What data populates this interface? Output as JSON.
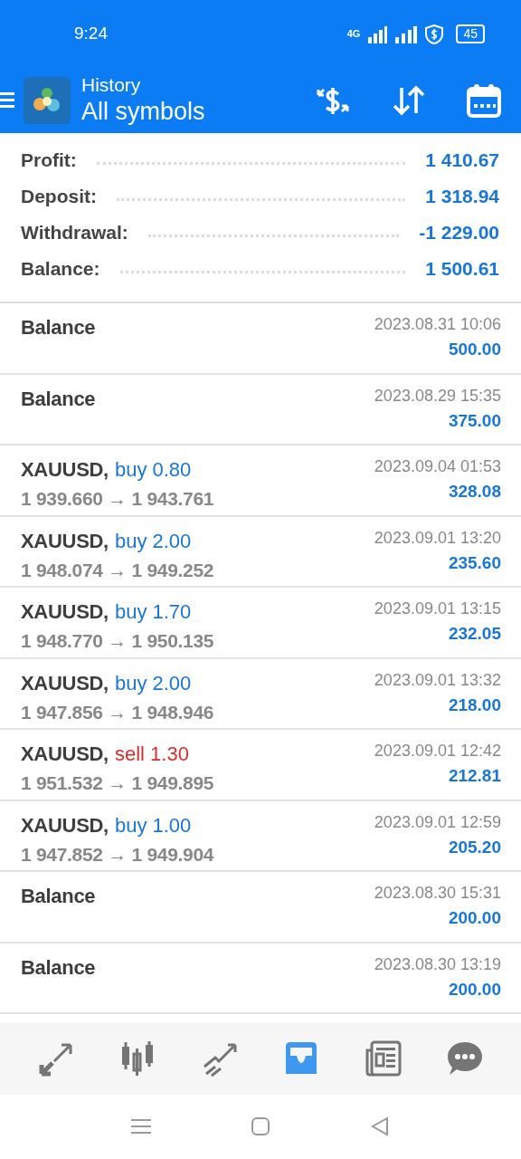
{
  "status_bar": {
    "time": "9:24",
    "network": "4G",
    "battery": "45"
  },
  "header": {
    "subtitle": "History",
    "title": "All symbols"
  },
  "summary": [
    {
      "label": "Profit:",
      "value": "1 410.67"
    },
    {
      "label": "Deposit:",
      "value": "1 318.94"
    },
    {
      "label": "Withdrawal:",
      "value": "-1 229.00"
    },
    {
      "label": "Balance:",
      "value": "1 500.61"
    }
  ],
  "deals": [
    {
      "kind": "balance",
      "title": "Balance",
      "time": "2023.08.31 10:06",
      "amount": "500.00"
    },
    {
      "kind": "balance",
      "title": "Balance",
      "time": "2023.08.29 15:35",
      "amount": "375.00"
    },
    {
      "kind": "trade",
      "symbol": "XAUUSD,",
      "side": "buy",
      "volume": "0.80",
      "prices": "1 939.660 → 1 943.761",
      "time": "2023.09.04 01:53",
      "amount": "328.08"
    },
    {
      "kind": "trade",
      "symbol": "XAUUSD,",
      "side": "buy",
      "volume": "2.00",
      "prices": "1 948.074 → 1 949.252",
      "time": "2023.09.01 13:20",
      "amount": "235.60"
    },
    {
      "kind": "trade",
      "symbol": "XAUUSD,",
      "side": "buy",
      "volume": "1.70",
      "prices": "1 948.770 → 1 950.135",
      "time": "2023.09.01 13:15",
      "amount": "232.05"
    },
    {
      "kind": "trade",
      "symbol": "XAUUSD,",
      "side": "buy",
      "volume": "2.00",
      "prices": "1 947.856 → 1 948.946",
      "time": "2023.09.01 13:32",
      "amount": "218.00"
    },
    {
      "kind": "trade",
      "symbol": "XAUUSD,",
      "side": "sell",
      "volume": "1.30",
      "prices": "1 951.532 → 1 949.895",
      "time": "2023.09.01 12:42",
      "amount": "212.81"
    },
    {
      "kind": "trade",
      "symbol": "XAUUSD,",
      "side": "buy",
      "volume": "1.00",
      "prices": "1 947.852 → 1 949.904",
      "time": "2023.09.01 12:59",
      "amount": "205.20"
    },
    {
      "kind": "balance",
      "title": "Balance",
      "time": "2023.08.30 15:31",
      "amount": "200.00"
    },
    {
      "kind": "balance",
      "title": "Balance",
      "time": "2023.08.30 13:19",
      "amount": "200.00"
    }
  ],
  "bottom_nav": [
    {
      "kind": "quotes",
      "selected": false
    },
    {
      "kind": "chart",
      "selected": false
    },
    {
      "kind": "trade",
      "selected": false
    },
    {
      "kind": "history",
      "selected": true
    },
    {
      "kind": "news",
      "selected": false
    },
    {
      "kind": "chat",
      "selected": false
    }
  ]
}
